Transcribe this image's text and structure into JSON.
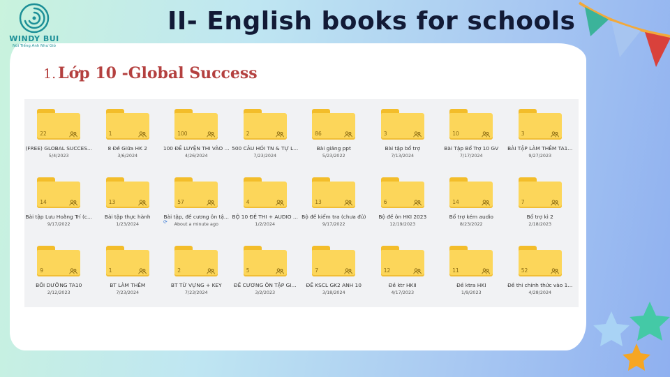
{
  "logo": {
    "brand": "WINDY BUI",
    "tagline": "Nói Tiếng Anh Như Gió"
  },
  "title": "II- English books for schools",
  "subtitle": {
    "number": "1.",
    "text": "Lớp 10 -Global Success"
  },
  "colors": {
    "title": "#121a36",
    "subtitle": "#b4403f",
    "folder": "#fcd65a",
    "folder_tab": "#f3bd2a"
  },
  "folders": [
    {
      "name": "(FREE) GLOBAL SUCCES...",
      "date": "5/4/2023",
      "count": "22"
    },
    {
      "name": "8 Đề Giữa HK 2",
      "date": "3/6/2024",
      "count": "1"
    },
    {
      "name": "100 ĐỀ LUYỆN THI VÀO ...",
      "date": "4/26/2024",
      "count": "100"
    },
    {
      "name": "500 CÂU HỎI TN & TỰ L...",
      "date": "7/23/2024",
      "count": "2"
    },
    {
      "name": "Bài giảng ppt",
      "date": "5/23/2022",
      "count": "86"
    },
    {
      "name": "Bài tập bổ trợ",
      "date": "7/13/2024",
      "count": "3"
    },
    {
      "name": "Bài Tập Bổ Trợ 10 GV",
      "date": "7/17/2024",
      "count": "10"
    },
    {
      "name": "BÀI TẬP LÀM THÊM TA1...",
      "date": "9/27/2023",
      "count": "3"
    },
    {
      "name": "Bài tập Lưu Hoằng Trí (c...",
      "date": "9/17/2022",
      "count": "14"
    },
    {
      "name": "Bài tập thực hành",
      "date": "1/23/2024",
      "count": "13"
    },
    {
      "name": "Bài tập, đề cương ôn tậ...",
      "date": "About a minute ago",
      "count": "57",
      "syncing": true
    },
    {
      "name": "BỘ 10 ĐỀ THI + AUDIO ...",
      "date": "1/2/2024",
      "count": "4"
    },
    {
      "name": "Bộ đề kiểm tra (chưa đủ)",
      "date": "9/17/2022",
      "count": "13"
    },
    {
      "name": "Bộ đề ôn HKI 2023",
      "date": "12/19/2023",
      "count": "6"
    },
    {
      "name": "Bổ trợ kém audio",
      "date": "8/23/2022",
      "count": "14"
    },
    {
      "name": "Bổ trợ kì 2",
      "date": "2/18/2023",
      "count": "7"
    },
    {
      "name": "BỒI DƯỠNG TA10",
      "date": "2/12/2023",
      "count": "9"
    },
    {
      "name": "BT LÀM THÊM",
      "date": "7/23/2024",
      "count": "1"
    },
    {
      "name": "BT TỪ VỰNG + KEY",
      "date": "7/23/2024",
      "count": "2"
    },
    {
      "name": "ĐỀ CƯƠNG ÔN TẬP GI...",
      "date": "3/2/2023",
      "count": "5"
    },
    {
      "name": "ĐỀ KSCL GK2 ANH 10",
      "date": "3/18/2024",
      "count": "7"
    },
    {
      "name": "Đề ktr HKII",
      "date": "4/17/2023",
      "count": "12"
    },
    {
      "name": "Đề ktra HKI",
      "date": "1/9/2023",
      "count": "11"
    },
    {
      "name": "Đề thi chính thức vào 1...",
      "date": "4/28/2024",
      "count": "52"
    }
  ]
}
